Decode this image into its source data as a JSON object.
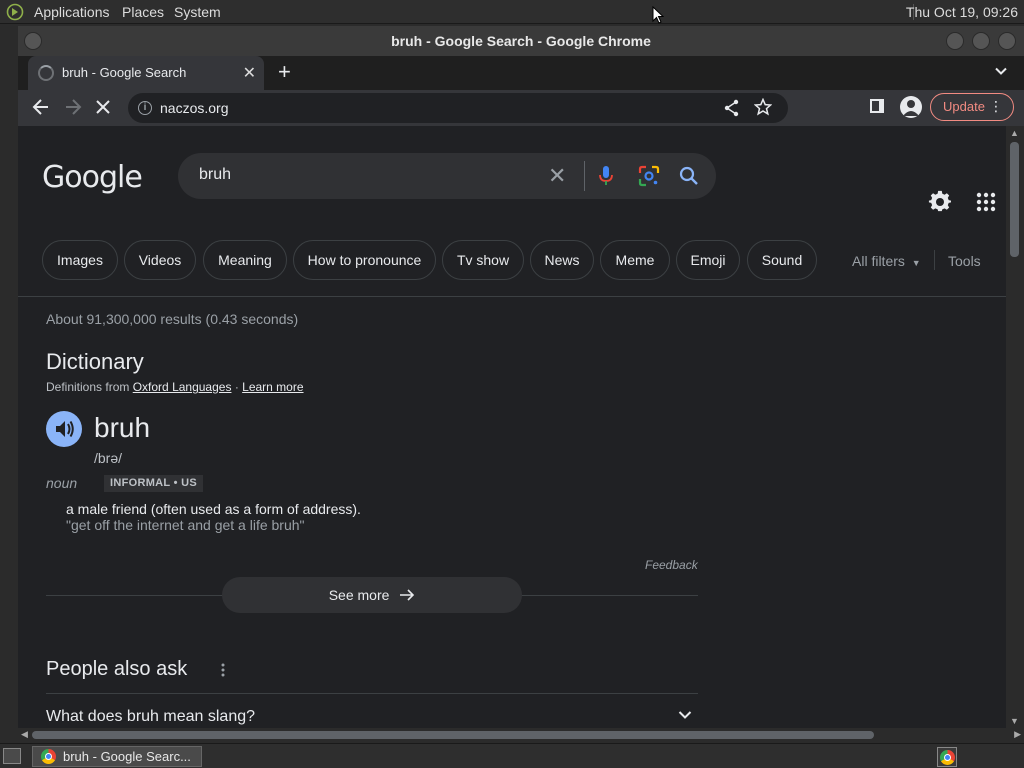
{
  "top_panel": {
    "menus": [
      "Applications",
      "Places",
      "System"
    ],
    "clock": "Thu Oct 19, 09:26"
  },
  "window": {
    "title": "bruh - Google Search - Google Chrome"
  },
  "tabs": [
    {
      "label": "bruh - Google Search",
      "active": true,
      "loading": true
    }
  ],
  "toolbar": {
    "url": "naczos.org",
    "update_label": "Update"
  },
  "search": {
    "logo": "Google",
    "query": "bruh"
  },
  "filters": {
    "chips": [
      "Images",
      "Videos",
      "Meaning",
      "How to pronounce",
      "Tv show",
      "News",
      "Meme",
      "Emoji",
      "Sound"
    ],
    "all_filters": "All filters",
    "tools": "Tools"
  },
  "results": {
    "stats": "About 91,300,000 results (0.43 seconds)"
  },
  "dictionary": {
    "title": "Dictionary",
    "source_prefix": "Definitions from",
    "source_link": "Oxford Languages",
    "source_sep": "·",
    "learn_more": "Learn more",
    "word": "bruh",
    "phonetic": "/brə/",
    "part_of_speech": "noun",
    "register": "INFORMAL • US",
    "definition": "a male friend (often used as a form of address).",
    "example": "\"get off the internet and get a life bruh\"",
    "feedback": "Feedback",
    "see_more": "See more"
  },
  "people_also_ask": {
    "title": "People also ask",
    "questions": [
      "What does bruh mean slang?"
    ]
  },
  "taskbar": {
    "task_label": "bruh - Google Searc..."
  },
  "colors": {
    "page_bg": "#202124",
    "accent_blue": "#8ab4f8",
    "update_red": "#f28b82"
  }
}
